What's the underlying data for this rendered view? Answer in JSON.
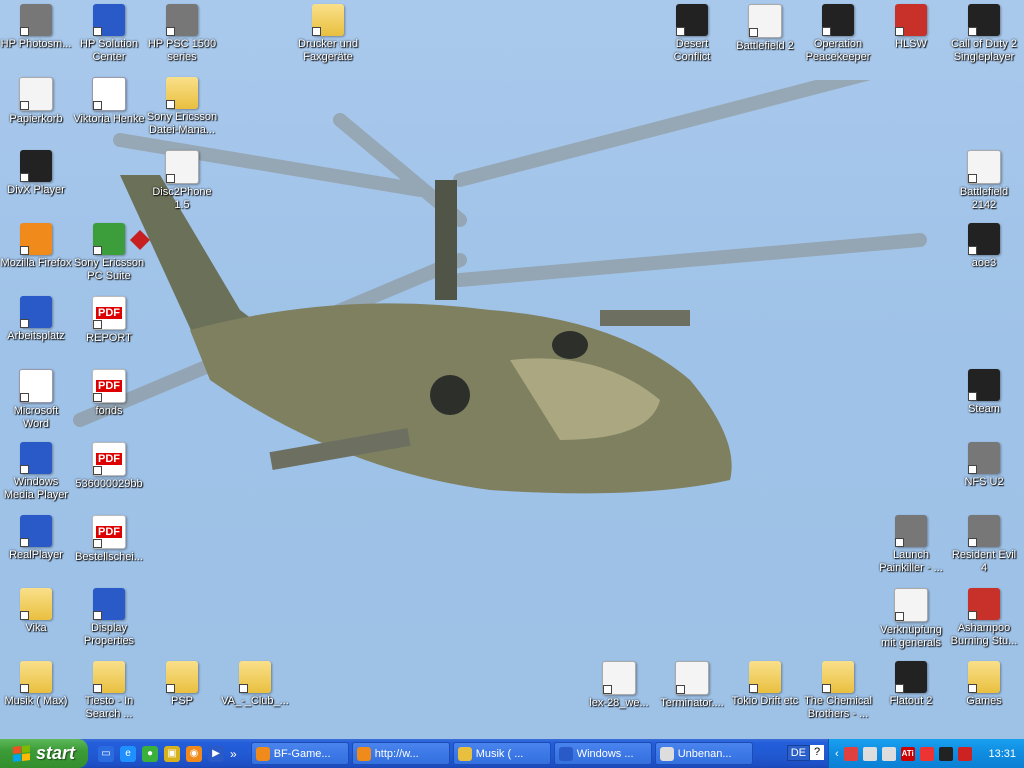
{
  "desktop_icons": [
    {
      "label": "HP Photosm...",
      "icon": "photosmart-icon",
      "style": "gray"
    },
    {
      "label": "HP Solution Center",
      "icon": "solution-center-icon",
      "style": "blue"
    },
    {
      "label": "HP PSC 1500 series",
      "icon": "printer-icon",
      "style": "gray"
    },
    {
      "label": "Drucker und Faxgeräte",
      "icon": "folder-printer-icon",
      "style": "folder"
    },
    {
      "label": "Desert Conflict",
      "icon": "desert-conflict-icon",
      "style": "dark"
    },
    {
      "label": "Battlefield 2",
      "icon": "battlefield2-icon",
      "style": "white"
    },
    {
      "label": "Operation Peacekeeper",
      "icon": "peacekeeper-icon",
      "style": "dark"
    },
    {
      "label": "HLSW",
      "icon": "hlsw-icon",
      "style": "red"
    },
    {
      "label": "Call of Duty 2 Singleplayer",
      "icon": "cod2-icon",
      "style": "dark"
    },
    {
      "label": "Papierkorb",
      "icon": "recycle-bin-icon",
      "style": "white"
    },
    {
      "label": "Viktoria Henke",
      "icon": "word-doc-icon",
      "style": "word"
    },
    {
      "label": "Sony Ericsson Datei-Mana...",
      "icon": "folder-phone-icon",
      "style": "folder"
    },
    {
      "label": "DivX Player",
      "icon": "divx-icon",
      "style": "dark"
    },
    {
      "label": "Disc2Phone 1.5",
      "icon": "disc2phone-icon",
      "style": "white"
    },
    {
      "label": "Battlefield 2142",
      "icon": "bf2142-icon",
      "style": "white"
    },
    {
      "label": "Mozilla Firefox",
      "icon": "firefox-icon",
      "style": "orange"
    },
    {
      "label": "Sony Ericsson PC Suite",
      "icon": "pc-suite-icon",
      "style": "green"
    },
    {
      "label": "aoe3",
      "icon": "aoe3-icon",
      "style": "dark"
    },
    {
      "label": "Arbeitsplatz",
      "icon": "my-computer-icon",
      "style": "blue"
    },
    {
      "label": "REPORT",
      "icon": "pdf-icon",
      "style": "pdf"
    },
    {
      "label": "Microsoft Word",
      "icon": "ms-word-icon",
      "style": "word"
    },
    {
      "label": "fonds",
      "icon": "pdf-icon",
      "style": "pdf"
    },
    {
      "label": "Steam",
      "icon": "steam-icon",
      "style": "dark"
    },
    {
      "label": "Windows Media Player",
      "icon": "media-player-icon",
      "style": "blue"
    },
    {
      "label": "536000029bb",
      "icon": "pdf-icon",
      "style": "pdf"
    },
    {
      "label": "NFS U2",
      "icon": "nfs-icon",
      "style": "gray"
    },
    {
      "label": "RealPlayer",
      "icon": "realplayer-icon",
      "style": "blue"
    },
    {
      "label": "Bestellschei...",
      "icon": "pdf-icon",
      "style": "pdf"
    },
    {
      "label": "Launch Painkiller - ...",
      "icon": "painkiller-icon",
      "style": "gray"
    },
    {
      "label": "Resident Evil 4",
      "icon": "re4-icon",
      "style": "gray"
    },
    {
      "label": "Vika",
      "icon": "folder-icon",
      "style": "folder"
    },
    {
      "label": "Display Properties",
      "icon": "display-icon",
      "style": "blue"
    },
    {
      "label": "Verknüpfung mit generals",
      "icon": "generals-icon",
      "style": "white"
    },
    {
      "label": "Ashampoo Burning Stu...",
      "icon": "ashampoo-icon",
      "style": "red"
    },
    {
      "label": "Musik ( Max)",
      "icon": "folder-icon",
      "style": "folder"
    },
    {
      "label": "Tiesto - In Search ...",
      "icon": "folder-icon",
      "style": "folder"
    },
    {
      "label": "PSP",
      "icon": "folder-icon",
      "style": "folder"
    },
    {
      "label": "VA_-_Club_...",
      "icon": "folder-icon",
      "style": "folder"
    },
    {
      "label": "lex-28_we...",
      "icon": "avi-icon",
      "style": "white"
    },
    {
      "label": "Terminator....",
      "icon": "avi-icon",
      "style": "white"
    },
    {
      "label": "Tokio Drift etc",
      "icon": "folder-icon",
      "style": "folder"
    },
    {
      "label": "The Chemical Brothers - ...",
      "icon": "folder-icon",
      "style": "folder"
    },
    {
      "label": "Flatout 2",
      "icon": "flatout2-icon",
      "style": "dark"
    },
    {
      "label": "Games",
      "icon": "folder-icon",
      "style": "folder"
    }
  ],
  "taskbar": {
    "start_label": "start",
    "quick_launch": [
      "show-desktop-icon",
      "ie-icon",
      "messenger-icon",
      "media-icon",
      "firefox-icon",
      "wmp-icon"
    ],
    "overflow": "»",
    "tasks": [
      {
        "label": "BF-Game...",
        "icon": "firefox-icon",
        "color": "#f08a1a"
      },
      {
        "label": "http://w...",
        "icon": "firefox-icon",
        "color": "#f08a1a"
      },
      {
        "label": "Musik ( ...",
        "icon": "folder-icon",
        "color": "#e9bf3f"
      },
      {
        "label": "Windows ...",
        "icon": "wmp-icon",
        "color": "#2a59c8"
      },
      {
        "label": "Unbenan...",
        "icon": "paint-icon",
        "color": "#dddddd"
      }
    ],
    "language": "DE",
    "help": "?",
    "clock": "13:31"
  }
}
